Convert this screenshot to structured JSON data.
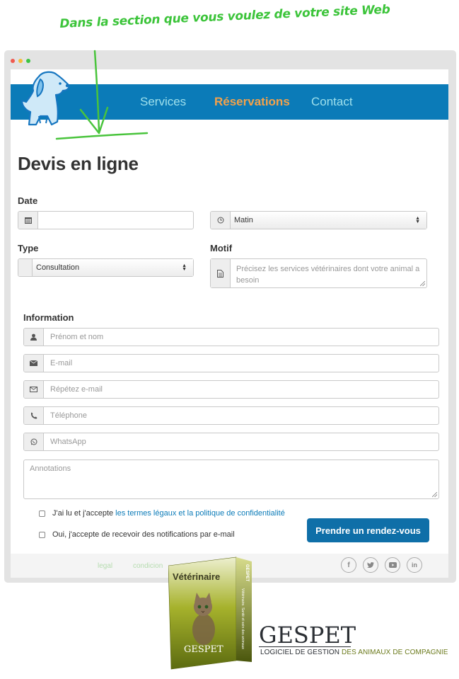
{
  "annotation": {
    "text": "Dans la section que vous voulez de votre site Web"
  },
  "nav": {
    "services": "Services",
    "reservations": "Réservations",
    "contact": "Contact"
  },
  "page_title": "Devis en ligne",
  "date_section": {
    "label": "Date",
    "date_value": "",
    "time_selected": "Matin"
  },
  "type_section": {
    "label": "Type",
    "selected": "Consultation"
  },
  "motif_section": {
    "label": "Motif",
    "placeholder": "Précisez les services vétérinaires dont votre animal a besoin"
  },
  "information": {
    "label": "Information",
    "fields": {
      "name": "Prénom et nom",
      "email": "E-mail",
      "email_repeat": "Répétez e-mail",
      "phone": "Téléphone",
      "whatsapp": "WhatsApp",
      "annotations": "Annotations"
    }
  },
  "consent": {
    "legal_prefix": "J'ai lu et j'accepte",
    "legal_link": "les termes légaux et la politique de confidentialité",
    "notifications": "Oui, j'accepte de recevoir des notifications par e-mail"
  },
  "submit_label": "Prendre un rendez-vous",
  "footer": {
    "links": [
      "legal",
      "condicion"
    ]
  },
  "product": {
    "box_title": "Vétérinaire",
    "box_brand": "GESPET",
    "box_side_top": "GESPET",
    "box_side": "Vétérinaire. Santé et soin des animaux",
    "brand": "GESPET",
    "tagline_part1": "LOGICIEL DE GESTION ",
    "tagline_part2": "DES ANIMAUX DE COMPAGNIE"
  },
  "colors": {
    "nav_bg": "#0b7bb8",
    "accent_orange": "#f4a24a",
    "button": "#0f6fa8",
    "annotation_green": "#3cc43a"
  }
}
